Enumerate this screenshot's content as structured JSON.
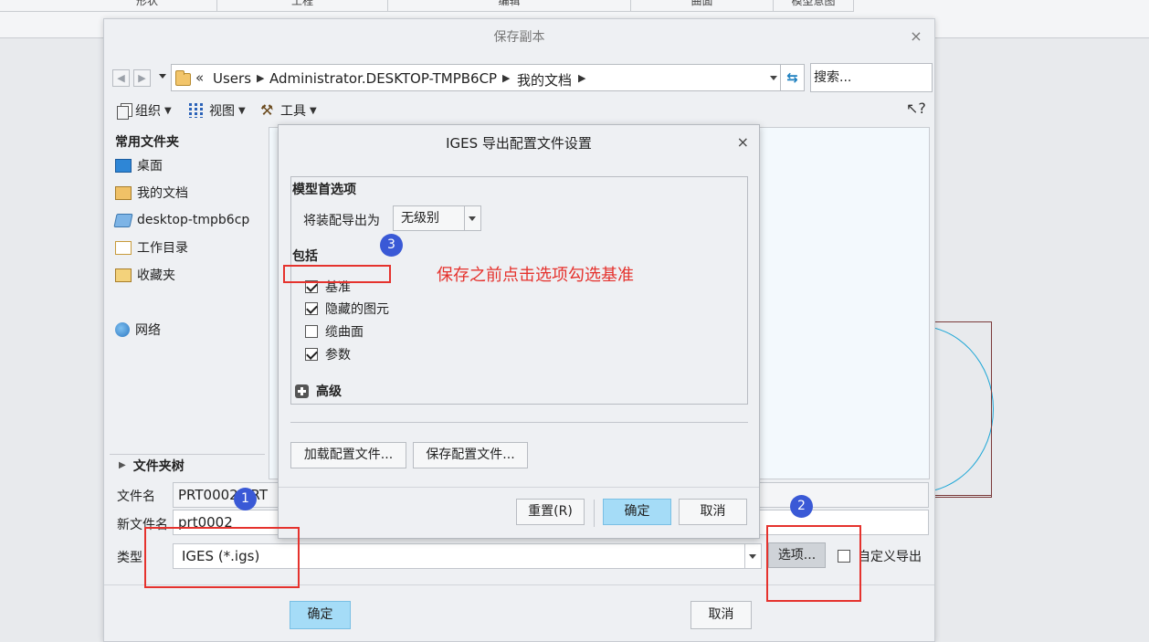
{
  "ribbon": {
    "tabs": [
      "形状",
      "工程",
      "编辑",
      "曲面",
      "模型意图"
    ]
  },
  "save_dialog": {
    "title": "保存副本",
    "close_glyph": "×",
    "path": {
      "chevrons": "«",
      "segments": [
        "Users",
        "Administrator.DESKTOP-TMPB6CP",
        "我的文档"
      ]
    },
    "search_placeholder": "搜索...",
    "toolbar": {
      "organize": "组织",
      "view": "视图",
      "tools": "工具"
    },
    "left_pane": {
      "heading": "常用文件夹",
      "items": [
        "桌面",
        "我的文档",
        "desktop-tmpb6cp",
        "工作目录",
        "收藏夹",
        "网络"
      ],
      "folder_tree": "文件夹树"
    },
    "fields": {
      "filename_label": "文件名",
      "filename_value": "PRT0002.PRT",
      "new_filename_label": "新文件名",
      "new_filename_value": "prt0002",
      "type_label": "类型",
      "type_value": "IGES (*.igs)"
    },
    "options_button": "选项...",
    "custom_export_label": "自定义导出",
    "ok": "确定",
    "cancel": "取消"
  },
  "iges_dialog": {
    "title": "IGES 导出配置文件设置",
    "close_glyph": "×",
    "model_prefs_heading": "模型首选项",
    "assembly_export_label": "将装配导出为",
    "assembly_export_value": "无级别",
    "include_heading": "包括",
    "include_items": [
      {
        "label": "基准",
        "checked": true
      },
      {
        "label": "隐藏的图元",
        "checked": true
      },
      {
        "label": "缆曲面",
        "checked": false
      },
      {
        "label": "参数",
        "checked": true
      }
    ],
    "advanced": "高级",
    "load_config": "加载配置文件...",
    "save_config": "保存配置文件...",
    "reset": "重置(R)",
    "ok": "确定",
    "cancel": "取消"
  },
  "annotations": {
    "badges": [
      "1",
      "2",
      "3"
    ],
    "note": "保存之前点击选项勾选基准",
    "color": "#e5322d",
    "badge_color": "#3a59d6"
  }
}
